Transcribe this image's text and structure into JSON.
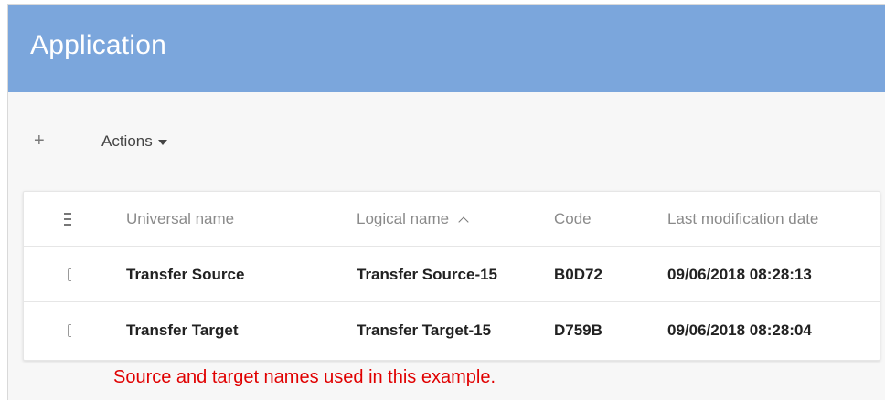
{
  "app": {
    "title": "Application"
  },
  "toolbar": {
    "add_label": "+",
    "actions_label": "Actions"
  },
  "table": {
    "columns": [
      "Universal name",
      "Logical name",
      "Code",
      "Last modification date"
    ],
    "sorted_column": "Logical name",
    "sort_direction": "ascending",
    "rows": [
      {
        "universal_name": "Transfer Source",
        "logical_name": "Transfer Source-15",
        "code": "B0D72",
        "last_modified": "09/06/2018 08:28:13",
        "selected": false
      },
      {
        "universal_name": "Transfer Target",
        "logical_name": "Transfer Target-15",
        "code": "D759B",
        "last_modified": "09/06/2018 08:28:04",
        "selected": false
      }
    ]
  },
  "annotation": {
    "text": "Source and target names used in this example.",
    "color": "#e00000"
  },
  "colors": {
    "header_bg": "#7ba6dc",
    "page_bg": "#f7f7f7"
  }
}
